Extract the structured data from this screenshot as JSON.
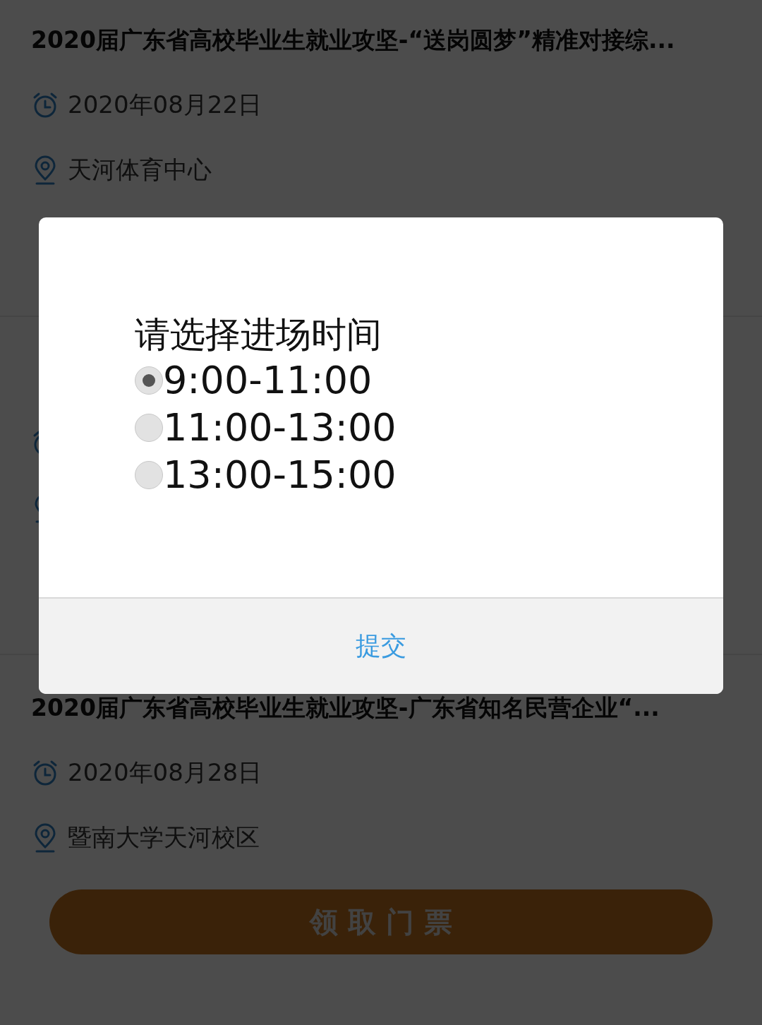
{
  "events": [
    {
      "kind": "full",
      "title": "2020届广东省高校毕业生就业攻坚-“送岗圆梦”精准对接综...",
      "date": "2020年08月22日",
      "place": "天河体育中心"
    },
    {
      "kind": "covered"
    },
    {
      "kind": "full",
      "title": "2020届广东省高校毕业生就业攻坚-广东省知名民营企业“...",
      "date": "2020年08月28日",
      "place": "暨南大学天河校区"
    }
  ],
  "ticket_button": "领 取 门 票",
  "dialog": {
    "prompt": "请选择进场时间",
    "options": [
      {
        "label": "9:00-11:00",
        "selected": true
      },
      {
        "label": "11:00-13:00",
        "selected": false
      },
      {
        "label": "13:00-15:00",
        "selected": false
      }
    ],
    "submit": "提交"
  }
}
